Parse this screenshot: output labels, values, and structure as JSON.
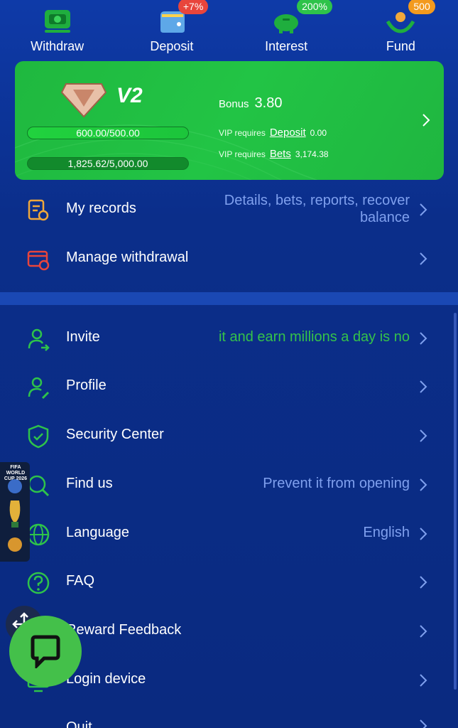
{
  "quick_actions": [
    {
      "label": "Withdraw",
      "icon": "withdraw-icon",
      "badge": ""
    },
    {
      "label": "Deposit",
      "icon": "wallet-icon",
      "badge": "+7%"
    },
    {
      "label": "Interest",
      "icon": "piggy-bank-icon",
      "badge": "200%"
    },
    {
      "label": "Fund",
      "icon": "fund-hands-icon",
      "badge": "500"
    }
  ],
  "vip": {
    "level": "V2",
    "bonus_label": "Bonus",
    "bonus_value": "3.80",
    "deposit_progress": "600.00/500.00",
    "bets_progress": "1,825.62/5,000.00",
    "req_deposit_prefix": "VIP requires",
    "req_deposit_link": "Deposit",
    "req_deposit_value": "0.00",
    "req_bets_prefix": "VIP requires",
    "req_bets_link": "Bets",
    "req_bets_value": "3,174.38"
  },
  "menu_top": [
    {
      "label": "My records",
      "right_line1": "Details, bets, reports, recover",
      "right_line2": "balance"
    },
    {
      "label": "Manage withdrawal",
      "right": ""
    }
  ],
  "menu_main": [
    {
      "label": "Invite",
      "right": "it and earn millions a day is no"
    },
    {
      "label": "Profile",
      "right": ""
    },
    {
      "label": "Security Center",
      "right": ""
    },
    {
      "label": "Find us",
      "right": "Prevent it from opening"
    },
    {
      "label": "Language",
      "right": "English"
    },
    {
      "label": "FAQ",
      "right": ""
    },
    {
      "label": "Reward Feedback",
      "right": ""
    },
    {
      "label": "Login device",
      "right": ""
    },
    {
      "label": "Quit",
      "right": ""
    }
  ],
  "fifa_widget": {
    "text": "FIFA WORLD CUP 2026"
  },
  "colors": {
    "background": "#0b2a82",
    "card_green": "#22c445",
    "accent_link": "#7fa0ee",
    "icon_green": "#2ec34a",
    "icon_orange": "#f0a83a",
    "icon_red": "#e8453c"
  }
}
